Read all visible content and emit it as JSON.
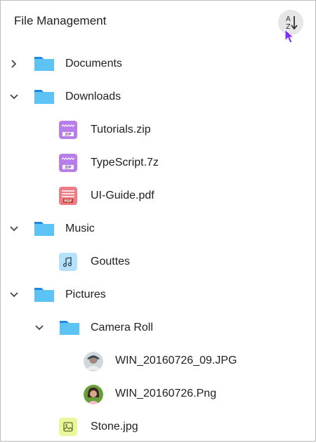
{
  "header": {
    "title": "File Management",
    "sort_icon": "sort-alpha-icon"
  },
  "tree": {
    "documents": "Documents",
    "downloads": "Downloads",
    "tutorials": "Tutorials.zip",
    "typescript": "TypeScript.7z",
    "uiguide": "UI-Guide.pdf",
    "music": "Music",
    "gouttes": "Gouttes",
    "pictures": "Pictures",
    "cameraroll": "Camera Roll",
    "win09": "WIN_20160726_09.JPG",
    "winpng": "WIN_20160726.Png",
    "stone": "Stone.jpg"
  },
  "icons": {
    "zip_text": "ZIP",
    "pdf_text": "PDF"
  },
  "colors": {
    "folder": "#5cc3f4",
    "folder_tab": "#2196f3",
    "zip": "#b77de8",
    "pdf": "#ec7c86",
    "music": "#b5e2fa",
    "image": "#ecf79c"
  }
}
